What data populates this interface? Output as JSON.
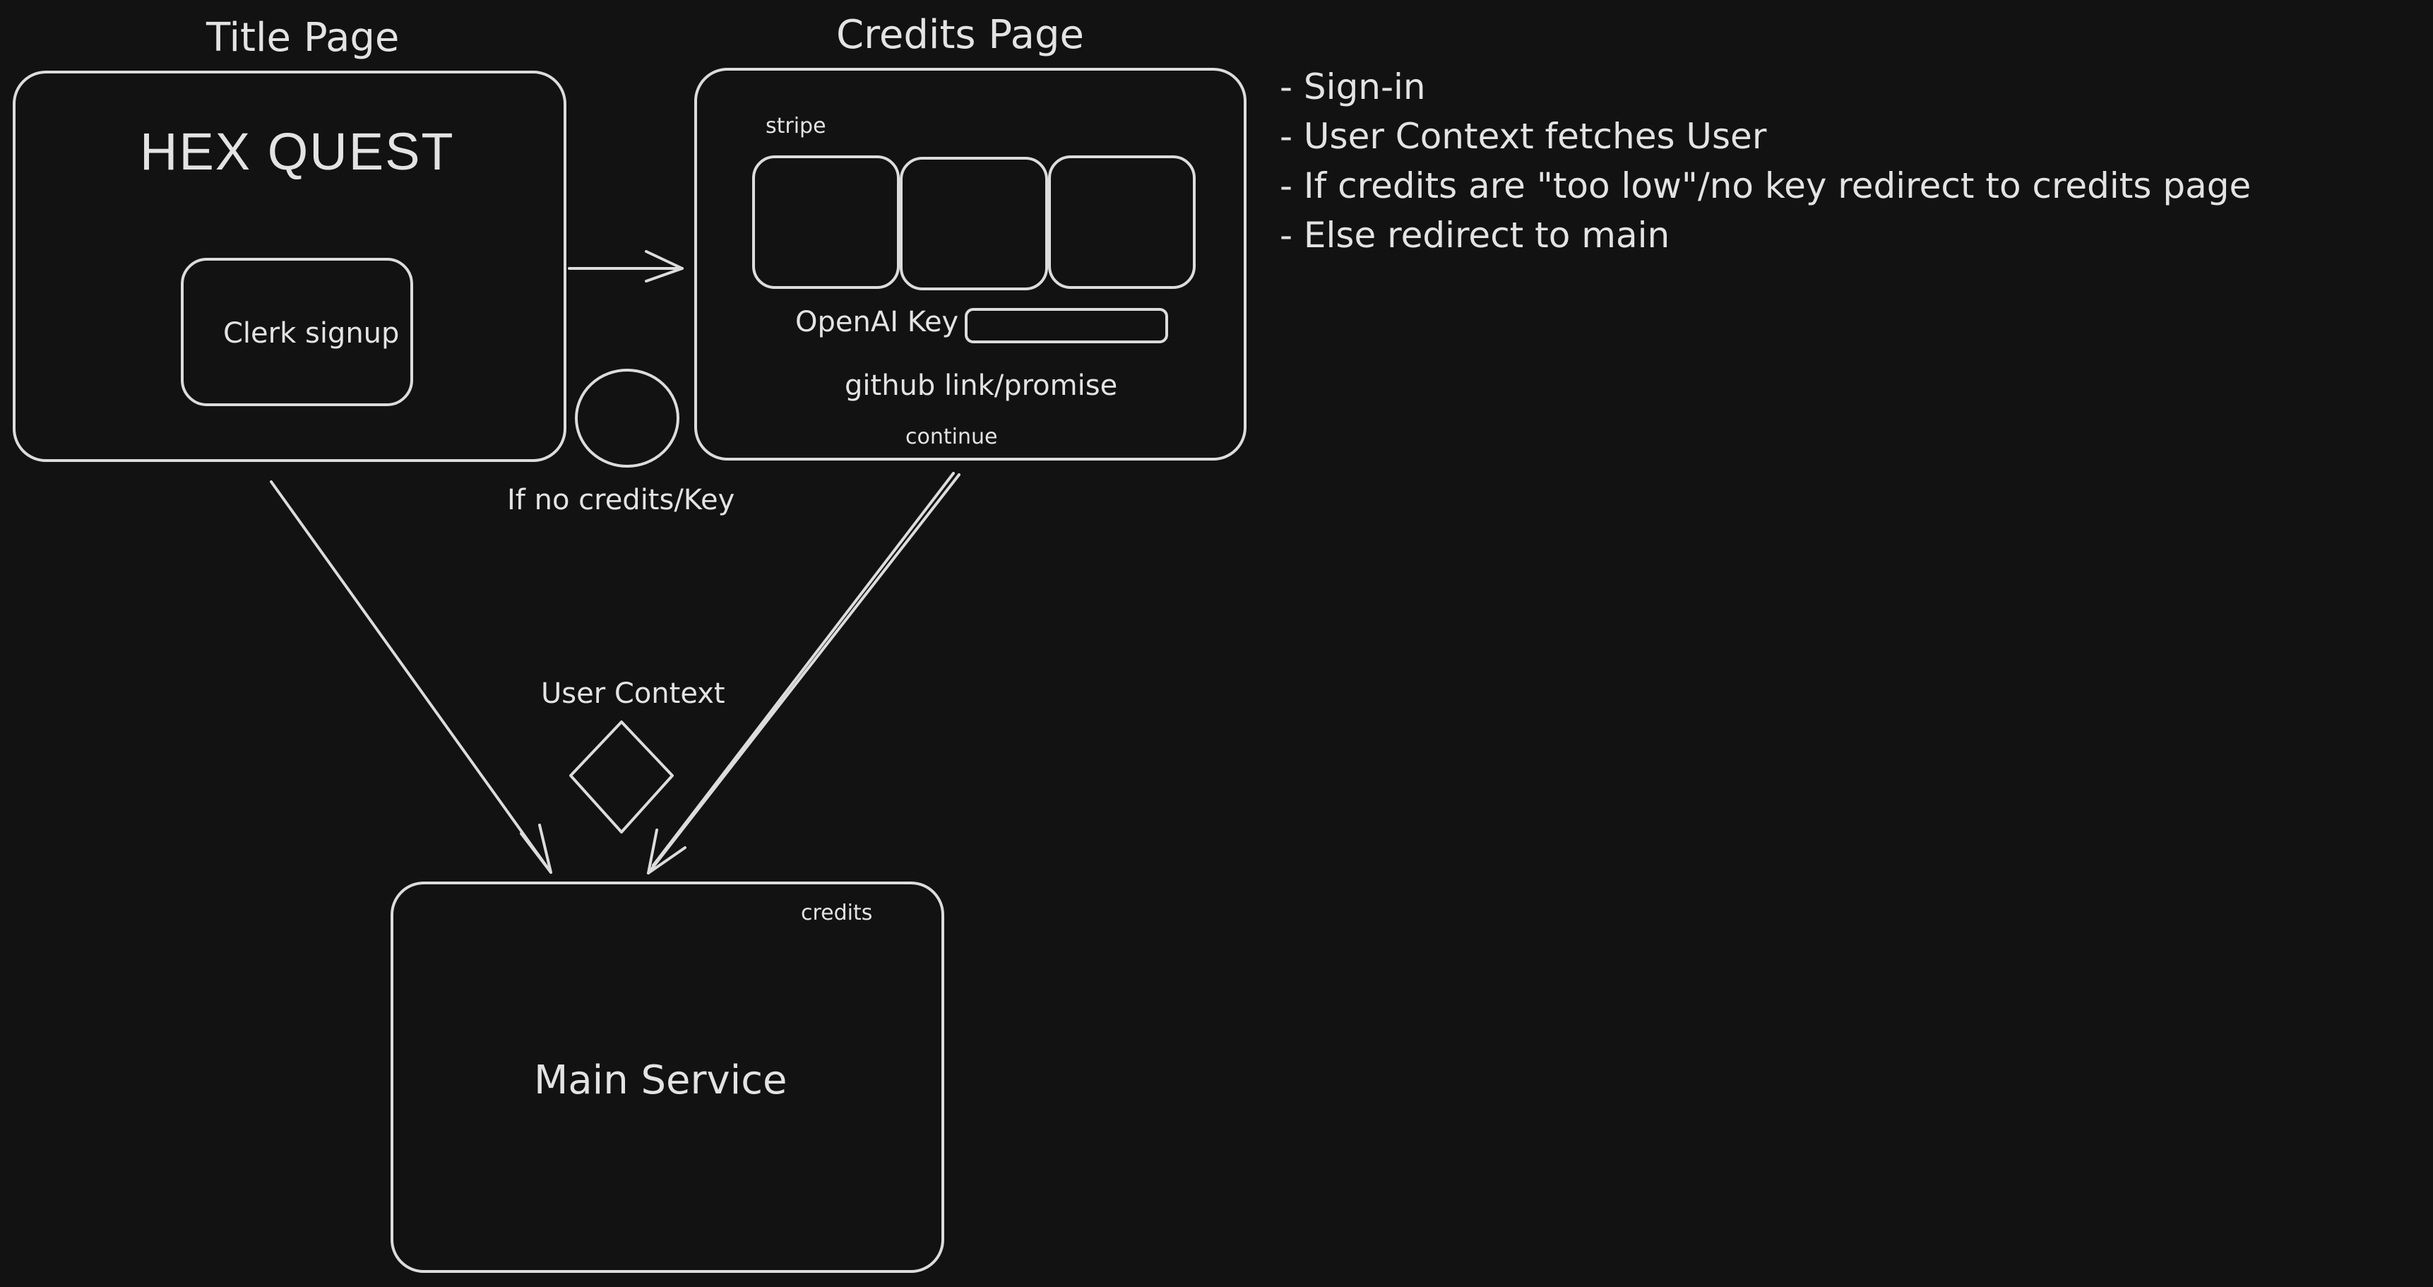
{
  "title_page": {
    "heading": "Title Page",
    "app_name": "HEX QUEST",
    "signup_label": "Clerk signup"
  },
  "credits_page": {
    "heading": "Credits Page",
    "stripe_label": "stripe",
    "openai_label": "OpenAI Key",
    "github_label": "github link/promise",
    "continue_label": "continue"
  },
  "decision": {
    "label": "If no credits/Key"
  },
  "user_context": {
    "label": "User Context"
  },
  "main_service": {
    "title": "Main Service",
    "credits_label": "credits"
  },
  "notes": [
    "- Sign-in",
    "- User Context fetches User",
    "- If credits are \"too low\"/no key redirect to credits page",
    "- Else redirect to main"
  ],
  "colors": {
    "background": "#121212",
    "stroke": "#dcdcdc",
    "text": "#e3e3e3"
  }
}
